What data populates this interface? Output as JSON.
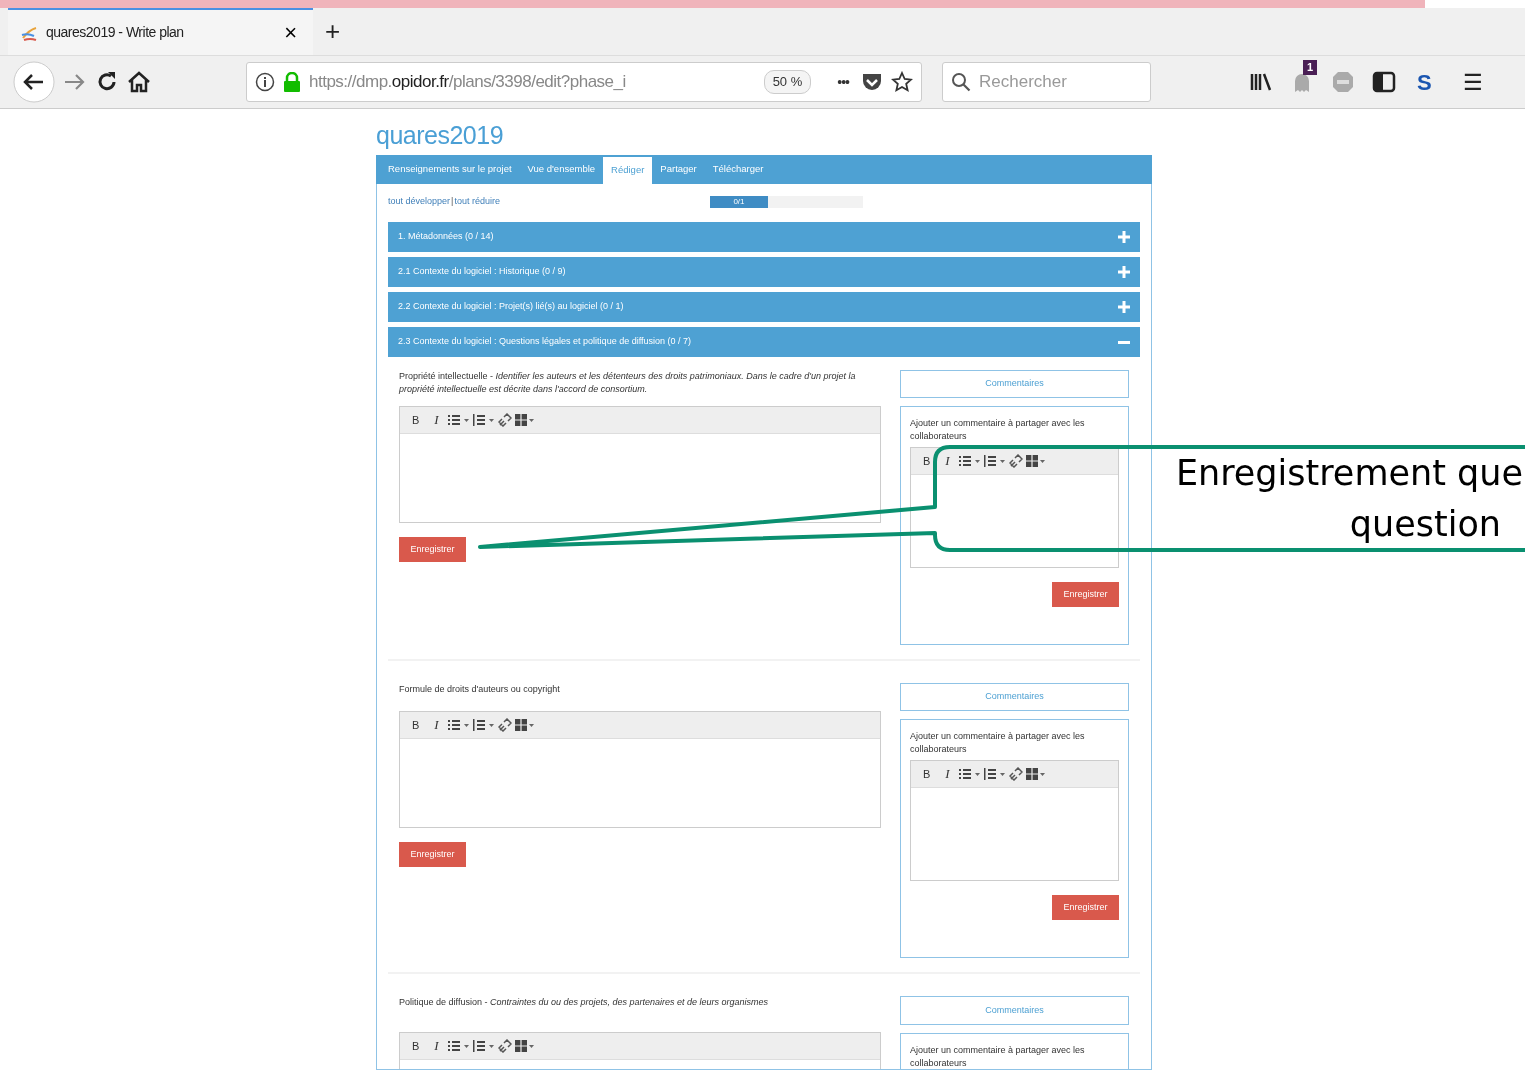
{
  "browser": {
    "tab": {
      "title": "quares2019 - Write plan",
      "close": "×",
      "selected": true
    },
    "new_tab": "+",
    "url": "https://dmp.**opidor.fr**/plans/3398/edit?phase_i",
    "zoom": "50 %",
    "more": "•••",
    "search": {
      "placeholder": "Rechercher"
    },
    "extension_badge": "1",
    "sync_label": "S",
    "menu": "☰"
  },
  "page": {
    "title": "quares2019",
    "tabs": [
      {
        "label": "Renseignements sur le projet",
        "selected": false
      },
      {
        "label": "Vue d'ensemble",
        "selected": false
      },
      {
        "label": "Rédiger",
        "selected": true
      },
      {
        "label": "Partager",
        "selected": false
      },
      {
        "label": "Télécharger",
        "selected": false
      }
    ],
    "expand_all": "tout développer",
    "separator": "|",
    "collapse_all": "tout réduire",
    "progress": {
      "label": "0/1",
      "level": 0.38
    },
    "sections": [
      {
        "title": "1. Métadonnées (0 / 14)",
        "expanded": false
      },
      {
        "title": "2.1 Contexte du logiciel : Historique (0 / 9)",
        "expanded": false
      },
      {
        "title": "2.2 Contexte du logiciel : Projet(s) lié(s) au logiciel (0 / 1)",
        "expanded": false
      },
      {
        "title": "2.3 Contexte du logiciel : Questions légales et politique de diffusion (0 / 7)",
        "expanded": true
      }
    ],
    "questions": [
      {
        "label": "Propriété intellectuelle - *Identifier les auteurs et les détenteurs des droits patrimoniaux. Dans le cadre d'un projet la propriété intellectuelle est décrite dans l'accord de consortium.*",
        "toolbar": {
          "bold": "B",
          "italic": "I"
        },
        "save": "Enregistrer",
        "comments_tab": "Commentaires",
        "comment_prompt": "Ajouter un commentaire à partager avec les collaborateurs",
        "comment_toolbar": {
          "bold": "B",
          "italic": "I"
        },
        "comment_save": "Enregistrer"
      },
      {
        "label": "Formule de droits d'auteurs ou copyright",
        "toolbar": {
          "bold": "B",
          "italic": "I"
        },
        "save": "Enregistrer",
        "comments_tab": "Commentaires",
        "comment_prompt": "Ajouter un commentaire à partager avec les collaborateurs",
        "comment_toolbar": {
          "bold": "B",
          "italic": "I"
        },
        "comment_save": "Enregistrer"
      },
      {
        "label": "Politique de diffusion - *Contraintes du ou des projets, des partenaires et de leurs organismes*",
        "toolbar": {
          "bold": "B",
          "italic": "I"
        },
        "comments_tab": "Commentaires",
        "comment_prompt": "Ajouter un commentaire à partager avec les collaborateurs"
      }
    ]
  },
  "callout": {
    "lines": [
      "Enregistrement que",
      "question"
    ]
  }
}
